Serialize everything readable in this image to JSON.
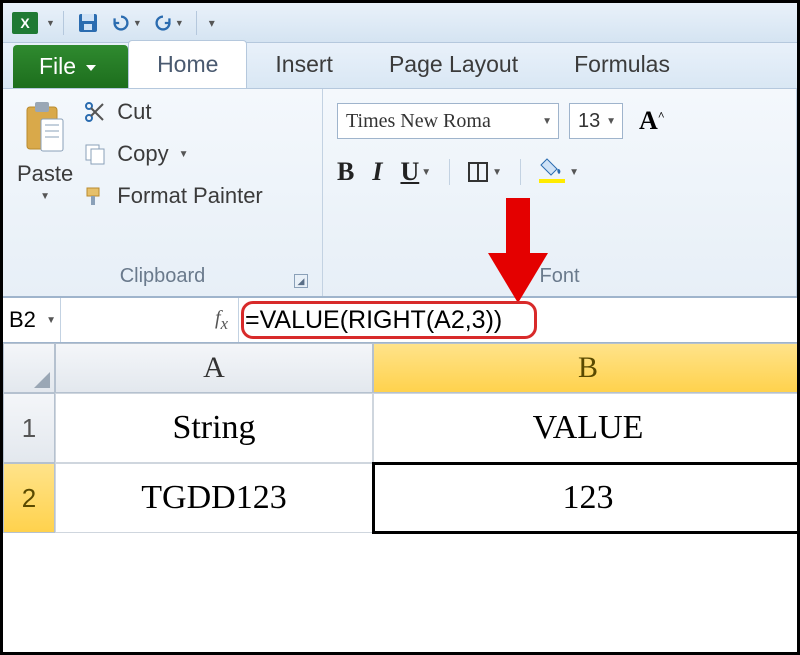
{
  "qat": {
    "save_tip": "Save",
    "undo_tip": "Undo",
    "redo_tip": "Redo"
  },
  "tabs": {
    "file": "File",
    "home": "Home",
    "insert": "Insert",
    "pagelayout": "Page Layout",
    "formulas": "Formulas"
  },
  "ribbon": {
    "clipboard": {
      "paste": "Paste",
      "cut": "Cut",
      "copy": "Copy",
      "format_painter": "Format Painter",
      "group_label": "Clipboard"
    },
    "font": {
      "font_name": "Times New Roma",
      "font_size": "13",
      "bold": "B",
      "italic": "I",
      "underline": "U",
      "group_label": "Font"
    }
  },
  "namebox": "B2",
  "formula": "=VALUE(RIGHT(A2,3))",
  "columns": {
    "A": "A",
    "B": "B"
  },
  "rows": {
    "r1": "1",
    "r2": "2"
  },
  "cells": {
    "A1": "String",
    "B1": "VALUE",
    "A2": "TGDD123",
    "B2": "123"
  }
}
